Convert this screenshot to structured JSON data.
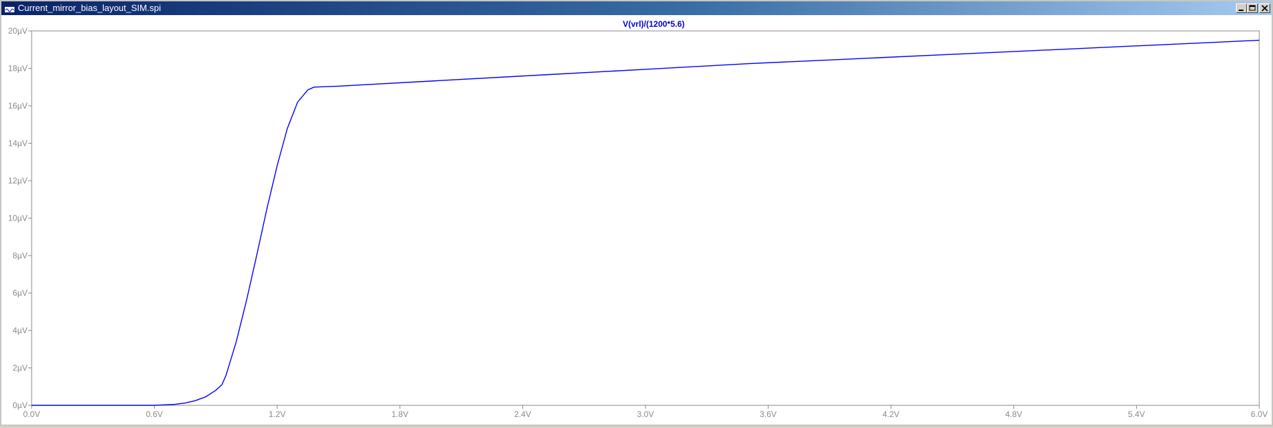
{
  "window": {
    "title": "Current_mirror_bias_layout_SIM.spi",
    "icons": [
      "waveform-app-icon",
      "minimize-icon",
      "maximize-icon",
      "close-icon"
    ]
  },
  "colors": {
    "trace": "#0000ff",
    "trace_label": "#0000d0",
    "axis": "#888888",
    "tick_text": "#8a8a8a",
    "background": "#ffffff"
  },
  "chart_data": {
    "type": "line",
    "title": "",
    "xlabel": "",
    "ylabel": "",
    "xlim": [
      0,
      6
    ],
    "ylim": [
      0,
      20
    ],
    "x_tick_labels": [
      "0.0V",
      "0.6V",
      "1.2V",
      "1.8V",
      "2.4V",
      "3.0V",
      "3.6V",
      "4.2V",
      "4.8V",
      "5.4V",
      "6.0V"
    ],
    "y_tick_labels": [
      "0µV",
      "2µV",
      "4µV",
      "6µV",
      "8µV",
      "10µV",
      "12µV",
      "14µV",
      "16µV",
      "18µV",
      "20µV"
    ],
    "x_unit": "V",
    "y_unit": "µV",
    "grid": false,
    "series": [
      {
        "name": "V(vrl)/(1200*5.6)",
        "x": [
          0.0,
          0.3,
          0.6,
          0.7,
          0.75,
          0.8,
          0.85,
          0.9,
          0.93,
          0.95,
          1.0,
          1.05,
          1.1,
          1.15,
          1.2,
          1.25,
          1.3,
          1.35,
          1.38,
          1.5,
          2.0,
          2.5,
          3.0,
          3.5,
          4.0,
          4.5,
          5.0,
          5.5,
          6.0
        ],
        "y": [
          0.0,
          0.0,
          0.0,
          0.05,
          0.12,
          0.25,
          0.45,
          0.8,
          1.1,
          1.6,
          3.4,
          5.6,
          8.0,
          10.5,
          12.8,
          14.8,
          16.2,
          16.85,
          17.0,
          17.05,
          17.35,
          17.65,
          17.95,
          18.25,
          18.5,
          18.75,
          19.0,
          19.25,
          19.5
        ]
      }
    ]
  }
}
